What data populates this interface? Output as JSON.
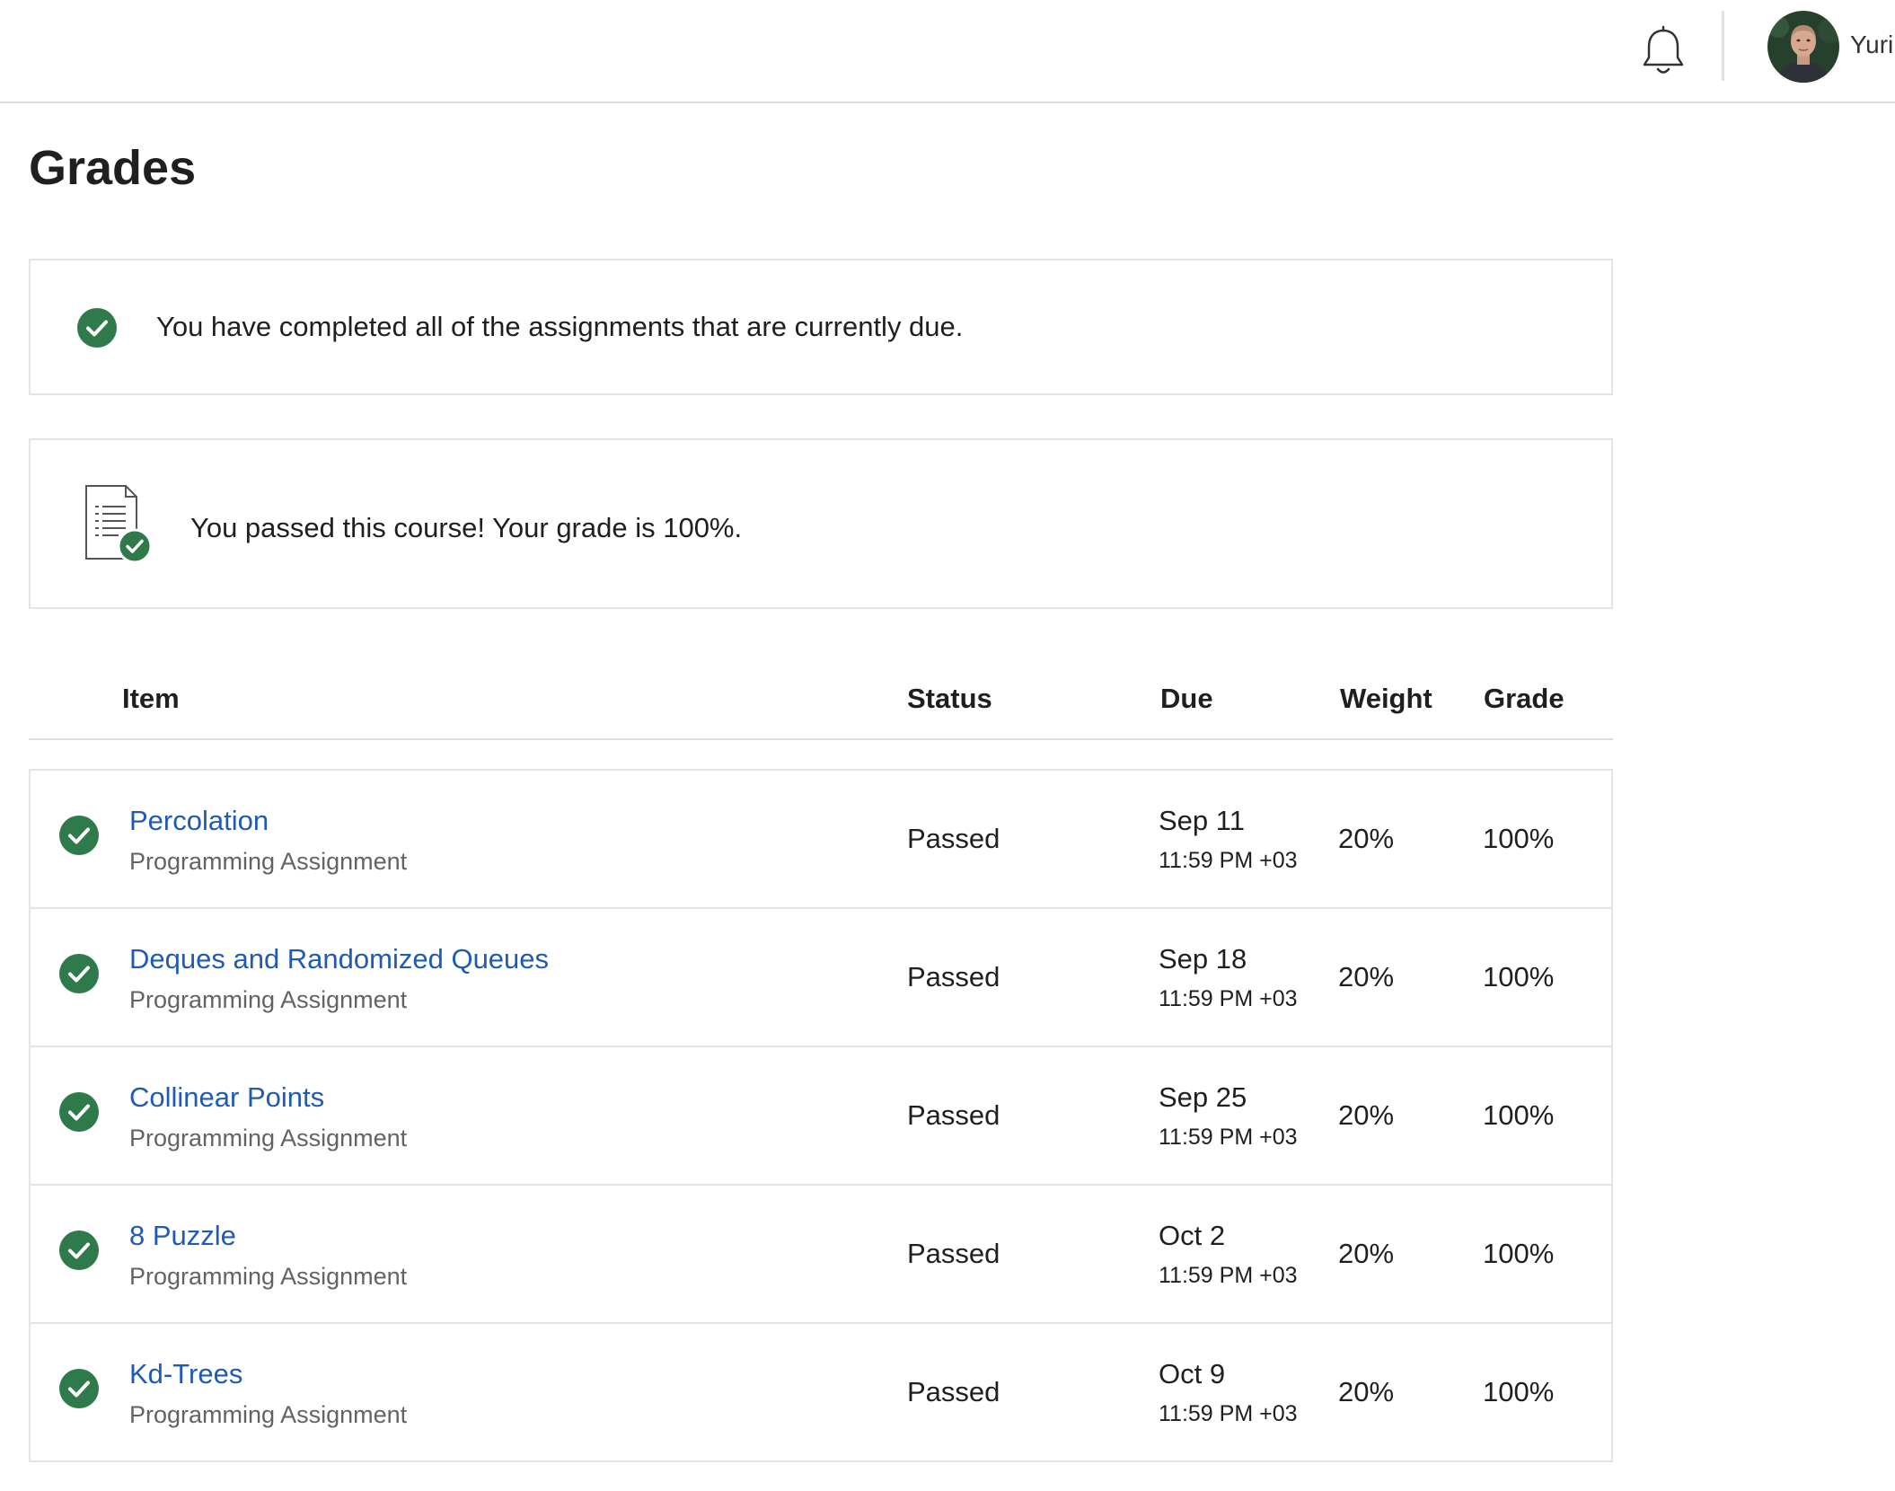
{
  "header": {
    "icons": {
      "notifications": "bell-icon",
      "avatar": "user-avatar"
    },
    "username": "Yuri"
  },
  "page": {
    "title": "Grades"
  },
  "notices": {
    "completed": {
      "icon": "check-circle-icon",
      "text": "You have completed all of the assignments that are currently due."
    },
    "passed": {
      "icon": "document-check-icon",
      "text": "You passed this course! Your grade is 100%."
    }
  },
  "table": {
    "headers": {
      "item": "Item",
      "status": "Status",
      "due": "Due",
      "weight": "Weight",
      "grade": "Grade"
    },
    "rows": [
      {
        "title": "Percolation",
        "type": "Programming Assignment",
        "status": "Passed",
        "due_date": "Sep 11",
        "due_time": "11:59 PM +03",
        "weight": "20%",
        "grade": "100%"
      },
      {
        "title": "Deques and Randomized Queues",
        "type": "Programming Assignment",
        "status": "Passed",
        "due_date": "Sep 18",
        "due_time": "11:59 PM +03",
        "weight": "20%",
        "grade": "100%"
      },
      {
        "title": "Collinear Points",
        "type": "Programming Assignment",
        "status": "Passed",
        "due_date": "Sep 25",
        "due_time": "11:59 PM +03",
        "weight": "20%",
        "grade": "100%"
      },
      {
        "title": "8 Puzzle",
        "type": "Programming Assignment",
        "status": "Passed",
        "due_date": "Oct 2",
        "due_time": "11:59 PM +03",
        "weight": "20%",
        "grade": "100%"
      },
      {
        "title": "Kd-Trees",
        "type": "Programming Assignment",
        "status": "Passed",
        "due_date": "Oct 9",
        "due_time": "11:59 PM +03",
        "weight": "20%",
        "grade": "100%"
      }
    ]
  },
  "colors": {
    "success": "#2e7a4a",
    "link": "#1f5bb5",
    "border": "#e3e3e3"
  }
}
